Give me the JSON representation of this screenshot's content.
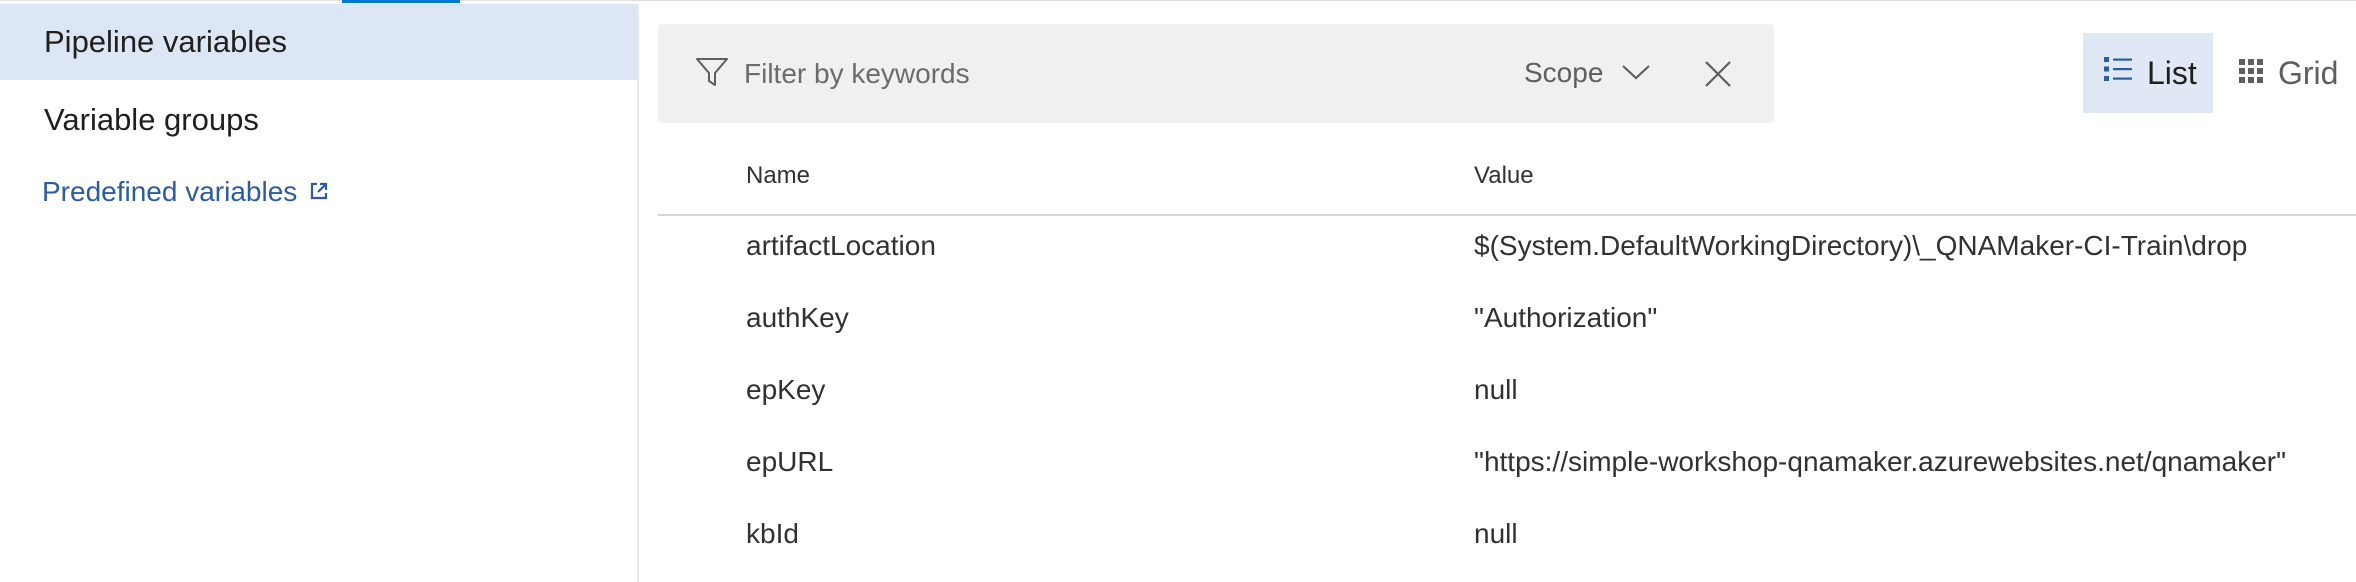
{
  "sidebar": {
    "items": [
      {
        "label": "Pipeline variables",
        "active": true
      },
      {
        "label": "Variable groups",
        "active": false
      }
    ],
    "link": {
      "label": "Predefined variables",
      "icon": "external-link-icon"
    }
  },
  "filter": {
    "placeholder": "Filter by keywords",
    "value": "",
    "scope_label": "Scope",
    "icons": {
      "filter": "filter-icon",
      "scope": "chevron-down-icon",
      "clear": "close-icon"
    }
  },
  "view_toggle": {
    "list_label": "List",
    "grid_label": "Grid",
    "selected": "List",
    "icons": {
      "list": "list-icon",
      "grid": "grid-icon"
    }
  },
  "table": {
    "columns": [
      "Name",
      "Value"
    ],
    "rows": [
      {
        "name": "artifactLocation",
        "value": "$(System.DefaultWorkingDirectory)\\_QNAMaker-CI-Train\\drop"
      },
      {
        "name": "authKey",
        "value": "\"Authorization\""
      },
      {
        "name": "epKey",
        "value": "null"
      },
      {
        "name": "epURL",
        "value": "\"https://simple-workshop-qnamaker.azurewebsites.net/qnamaker\""
      },
      {
        "name": "kbId",
        "value": "null"
      }
    ]
  },
  "colors": {
    "accent": "#0078d4",
    "selected_bg": "#dce6f5",
    "link": "#2b5c9e",
    "filter_bg": "#f0f0f0"
  }
}
